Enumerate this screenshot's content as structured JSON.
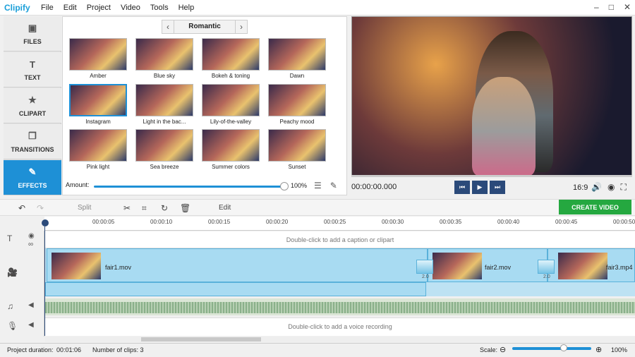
{
  "app": {
    "logo": "Clipify",
    "menu": [
      "File",
      "Edit",
      "Project",
      "Video",
      "Tools",
      "Help"
    ],
    "window_buttons": [
      "–",
      "□",
      "✕"
    ]
  },
  "nav": [
    {
      "label": "FILES",
      "icon": "image-icon",
      "glyph": "▣"
    },
    {
      "label": "TEXT",
      "icon": "text-icon",
      "glyph": "T"
    },
    {
      "label": "CLIPART",
      "icon": "star-icon",
      "glyph": "★"
    },
    {
      "label": "TRANSITIONS",
      "icon": "transitions-icon",
      "glyph": "❐"
    },
    {
      "label": "EFFECTS",
      "icon": "brush-icon",
      "glyph": "✎"
    }
  ],
  "effects": {
    "category": "Romantic",
    "tiles": [
      "Amber",
      "Blue sky",
      "Bokeh & toning",
      "Dawn",
      "Instagram",
      "Light in the bac...",
      "Lily-of-the-valley",
      "Peachy mood",
      "Pink light",
      "Sea breeze",
      "Summer colors",
      "Sunset"
    ],
    "selected": "Instagram",
    "amount_label": "Amount:",
    "amount_value": "100%",
    "amount_fraction": 1.0
  },
  "preview": {
    "timecode": "00:00:00.000",
    "ratio": "16:9",
    "progress_fraction": 0.0
  },
  "toolbar": {
    "split": "Split",
    "edit": "Edit",
    "create": "CREATE VIDEO"
  },
  "timeline": {
    "ticks": [
      "00:00:05",
      "00:00:10",
      "00:00:15",
      "00:00:20",
      "00:00:25",
      "00:00:30",
      "00:00:35",
      "00:00:40",
      "00:00:45",
      "00:00:50"
    ],
    "caption_hint": "Double-click to add a caption or clipart",
    "voice_hint": "Double-click to add a voice recording",
    "clips": [
      "fair1.mov",
      "fair2.mov",
      "fair3.mp4"
    ],
    "transition_values": [
      "2.0",
      "2.0"
    ]
  },
  "status": {
    "duration_label": "Project duration:",
    "duration": "00:01:06",
    "clips_label": "Number of clips: 3",
    "scale_label": "Scale:",
    "scale_value": "100%"
  }
}
